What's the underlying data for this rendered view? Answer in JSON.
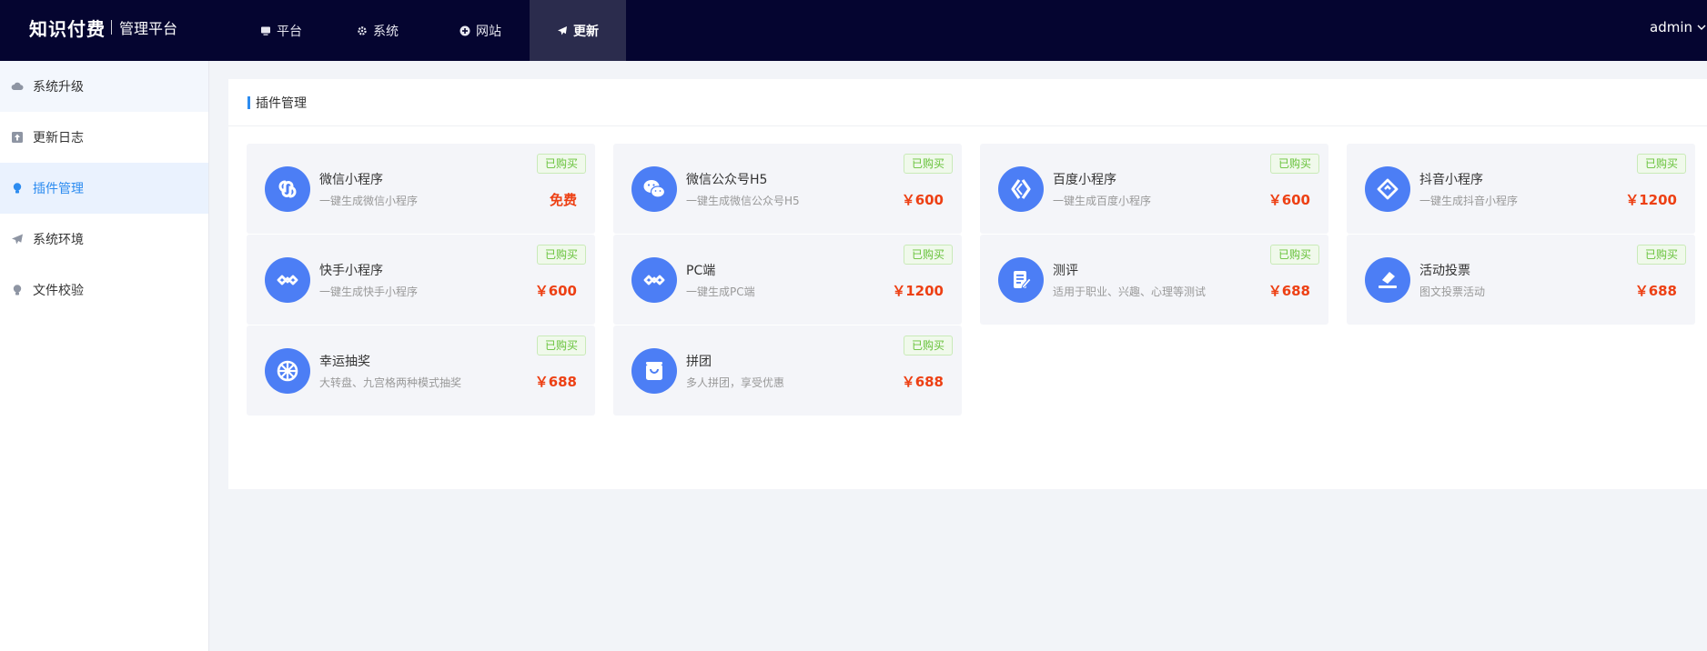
{
  "header": {
    "brand_main": "知识付费",
    "brand_sub": "管理平台",
    "nav": [
      {
        "label": "平台",
        "icon": "monitor-icon"
      },
      {
        "label": "系统",
        "icon": "gear-icon"
      },
      {
        "label": "网站",
        "icon": "plus-circle-icon"
      },
      {
        "label": "更新",
        "icon": "paper-plane-icon"
      }
    ],
    "user": "admin"
  },
  "sidebar": {
    "items": [
      {
        "label": "系统升级",
        "icon": "cloud-icon"
      },
      {
        "label": "更新日志",
        "icon": "upload-box-icon"
      },
      {
        "label": "插件管理",
        "icon": "bulb-icon"
      },
      {
        "label": "系统环境",
        "icon": "paper-plane-icon"
      },
      {
        "label": "文件校验",
        "icon": "bulb-icon"
      }
    ]
  },
  "panel": {
    "title": "插件管理",
    "plugins": [
      {
        "name": "微信小程序",
        "desc": "一键生成微信小程序",
        "badge": "已购买",
        "price": "免费",
        "icon": "mini-program-icon"
      },
      {
        "name": "微信公众号H5",
        "desc": "一键生成微信公众号H5",
        "badge": "已购买",
        "price": "￥600",
        "icon": "wechat-icon"
      },
      {
        "name": "百度小程序",
        "desc": "一键生成百度小程序",
        "badge": "已购买",
        "price": "￥600",
        "icon": "baidu-mini-icon"
      },
      {
        "name": "抖音小程序",
        "desc": "一键生成抖音小程序",
        "badge": "已购买",
        "price": "￥1200",
        "icon": "douyin-mini-icon"
      },
      {
        "name": "快手小程序",
        "desc": "一键生成快手小程序",
        "badge": "已购买",
        "price": "￥600",
        "icon": "kuaishou-icon"
      },
      {
        "name": "PC端",
        "desc": "一键生成PC端",
        "badge": "已购买",
        "price": "￥1200",
        "icon": "pc-infinity-icon"
      },
      {
        "name": "测评",
        "desc": "适用于职业、兴趣、心理等测试",
        "badge": "已购买",
        "price": "￥688",
        "icon": "edit-doc-icon"
      },
      {
        "name": "活动投票",
        "desc": "图文投票活动",
        "badge": "已购买",
        "price": "￥688",
        "icon": "vote-icon"
      },
      {
        "name": "幸运抽奖",
        "desc": "大转盘、九宫格两种模式抽奖",
        "badge": "已购买",
        "price": "￥688",
        "icon": "wheel-icon"
      },
      {
        "name": "拼团",
        "desc": "多人拼团，享受优惠",
        "badge": "已购买",
        "price": "￥688",
        "icon": "shopping-bag-icon"
      }
    ]
  },
  "colors": {
    "topbar": "#050530",
    "accent": "#2d8cf0",
    "icon_bg": "#4c7ef5",
    "price": "#ed4014",
    "badge": "#67c23a"
  }
}
